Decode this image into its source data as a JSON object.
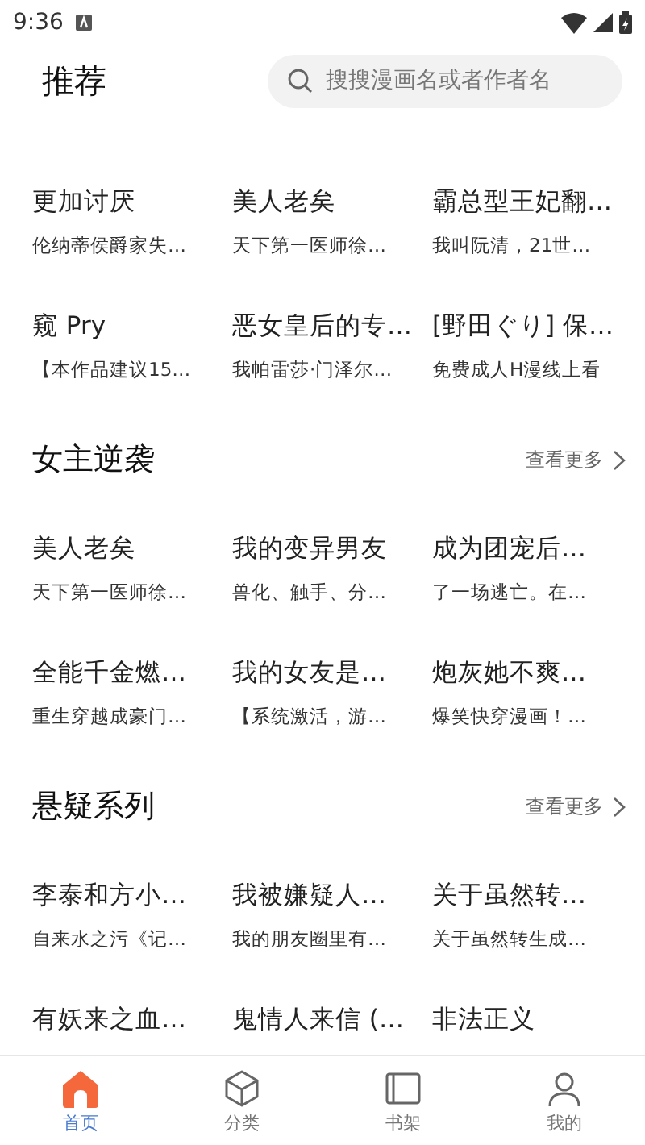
{
  "status_bar": {
    "time": "9:36"
  },
  "header": {
    "title": "推荐",
    "search": {
      "placeholder": "搜搜漫画名或者作者名"
    }
  },
  "sections": [
    {
      "books": [
        {
          "title": "更加讨厌",
          "desc": "伦纳蒂侯爵家失…"
        },
        {
          "title": "美人老矣",
          "desc": "天下第一医师徐…"
        },
        {
          "title": "霸总型王妃翻…",
          "desc": "我叫阮清，21世…"
        },
        {
          "title": "窥 Pry",
          "desc": "【本作品建议15…"
        },
        {
          "title": "恶女皇后的专…",
          "desc": "我帕雷莎·门泽尔…"
        },
        {
          "title": "[野田ぐり] 保…",
          "desc": "免费成人H漫线上看"
        }
      ]
    },
    {
      "title": "女主逆袭",
      "more": "查看更多",
      "books": [
        {
          "title": "美人老矣",
          "desc": "天下第一医师徐…"
        },
        {
          "title": "我的变异男友",
          "desc": "兽化、触手、分…"
        },
        {
          "title": "成为团宠后…",
          "desc": "了一场逃亡。在…"
        },
        {
          "title": "全能千金燃…",
          "desc": "重生穿越成豪门…"
        },
        {
          "title": "我的女友是…",
          "desc": "【系统激活，游…"
        },
        {
          "title": "炮灰她不爽…",
          "desc": "爆笑快穿漫画！…"
        }
      ]
    },
    {
      "title": "悬疑系列",
      "more": "查看更多",
      "books": [
        {
          "title": "李泰和方小…",
          "desc": "自来水之污《记…"
        },
        {
          "title": "我被嫌疑人…",
          "desc": "我的朋友圈里有…"
        },
        {
          "title": "关于虽然转…",
          "desc": "关于虽然转生成…"
        },
        {
          "title": "有妖来之血…"
        },
        {
          "title": "鬼情人来信 (…"
        },
        {
          "title": "非法正义"
        }
      ]
    }
  ],
  "bottom_nav": [
    {
      "kind": "home",
      "label": "首页",
      "selected": true
    },
    {
      "kind": "category",
      "label": "分类",
      "selected": false
    },
    {
      "kind": "shelf",
      "label": "书架",
      "selected": false
    },
    {
      "kind": "profile",
      "label": "我的",
      "selected": false
    }
  ]
}
